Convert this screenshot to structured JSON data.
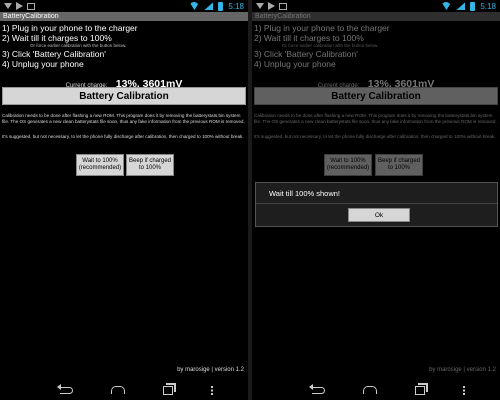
{
  "status_bar": {
    "time": "5:18"
  },
  "app": {
    "title": "BatteryCalibration",
    "steps": [
      "1) Plug in your phone to the charger",
      "2) Wait till it charges to 100%",
      "3) Click 'Battery Calibration'",
      "4) Unplug your phone"
    ],
    "step2_hint": "Or force earlier calibration with the button below.",
    "current_charge_label": "Current charge:",
    "current_charge_value": "13%, 3601mV",
    "calibrate_button": "Battery Calibration",
    "description1": "Calibration needs to be done after flashing a new ROM. This program does it by removing the batterystats.bin system file. The OS generates a new clean batterystats file soon, thus any fake information from the previous ROM is removed.",
    "description2": "It's suggested, but not necessary, to let the phone fully discharge after calibration, then charged to 100% without break.",
    "wait_button_line1": "Wait to 100%",
    "wait_button_line2": "(recommended)",
    "beep_button_line1": "Beep if charged",
    "beep_button_line2": "to 100%",
    "footer": "by marosige | version 1.2"
  },
  "dialog": {
    "message": "Wait till 100% shown!",
    "ok_label": "Ok"
  },
  "colors": {
    "accent": "#33b5e5",
    "title_bar": "#666666",
    "button_bg": "#d6d6d6"
  },
  "icons": [
    "download-icon",
    "play-store-icon",
    "notification-icon",
    "wifi-icon",
    "signal-icon",
    "battery-icon",
    "back-icon",
    "home-icon",
    "recent-apps-icon",
    "menu-icon"
  ]
}
